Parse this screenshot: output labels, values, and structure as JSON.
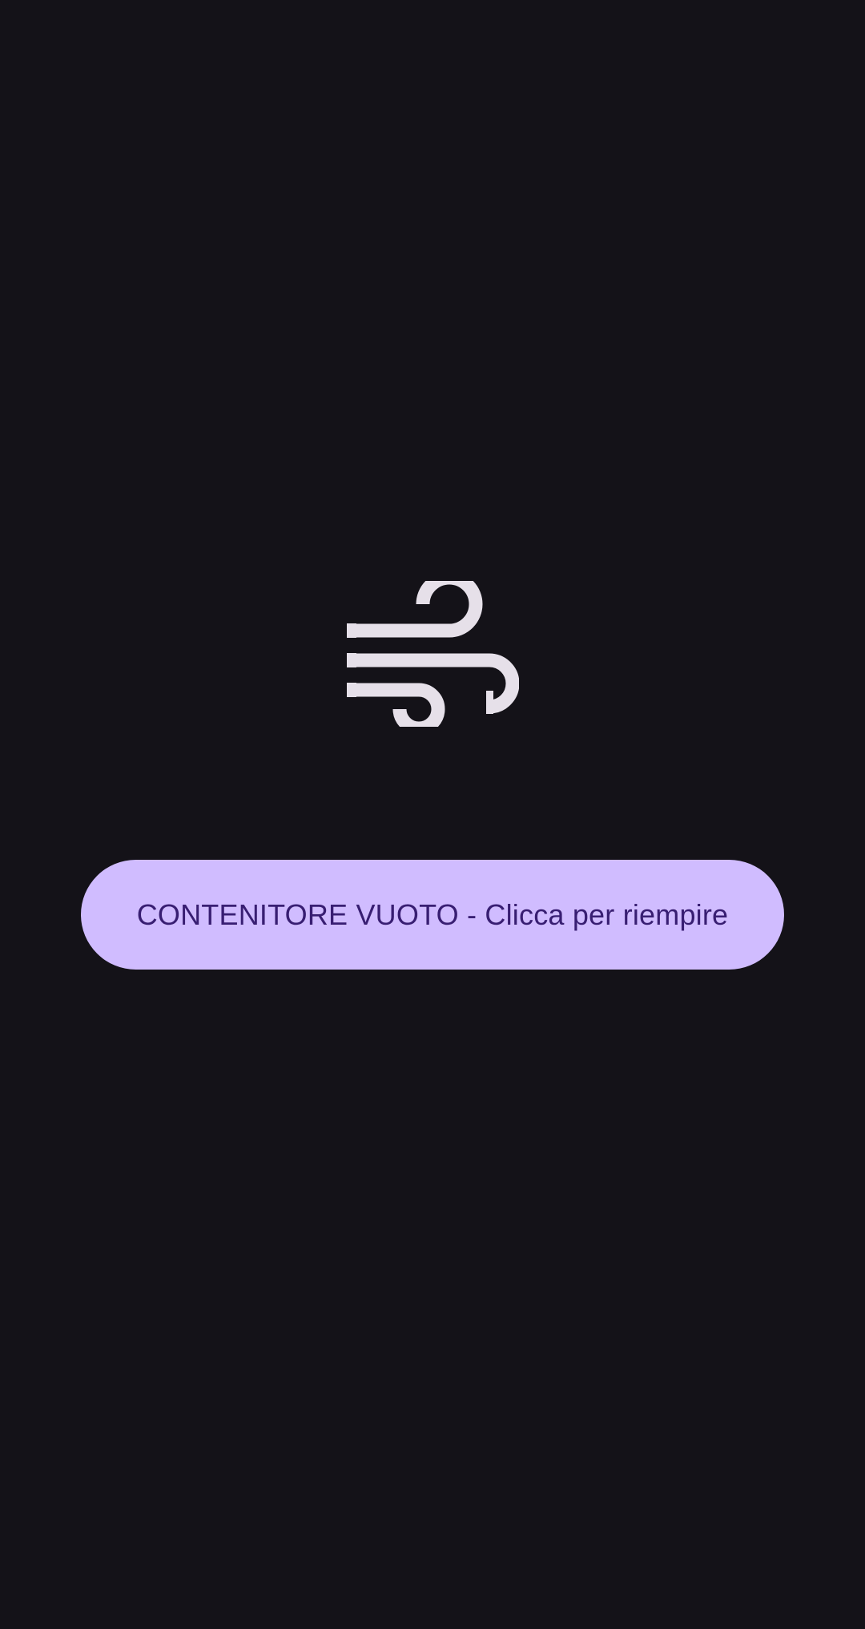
{
  "screen": {
    "icon": "air-wind-icon",
    "button": {
      "label": "CONTENITORE VUOTO - Clicca per riempire"
    }
  },
  "colors": {
    "background": "#141218",
    "icon": "#E6E0E9",
    "button_background": "#D0BCFF",
    "button_text": "#381E72"
  }
}
